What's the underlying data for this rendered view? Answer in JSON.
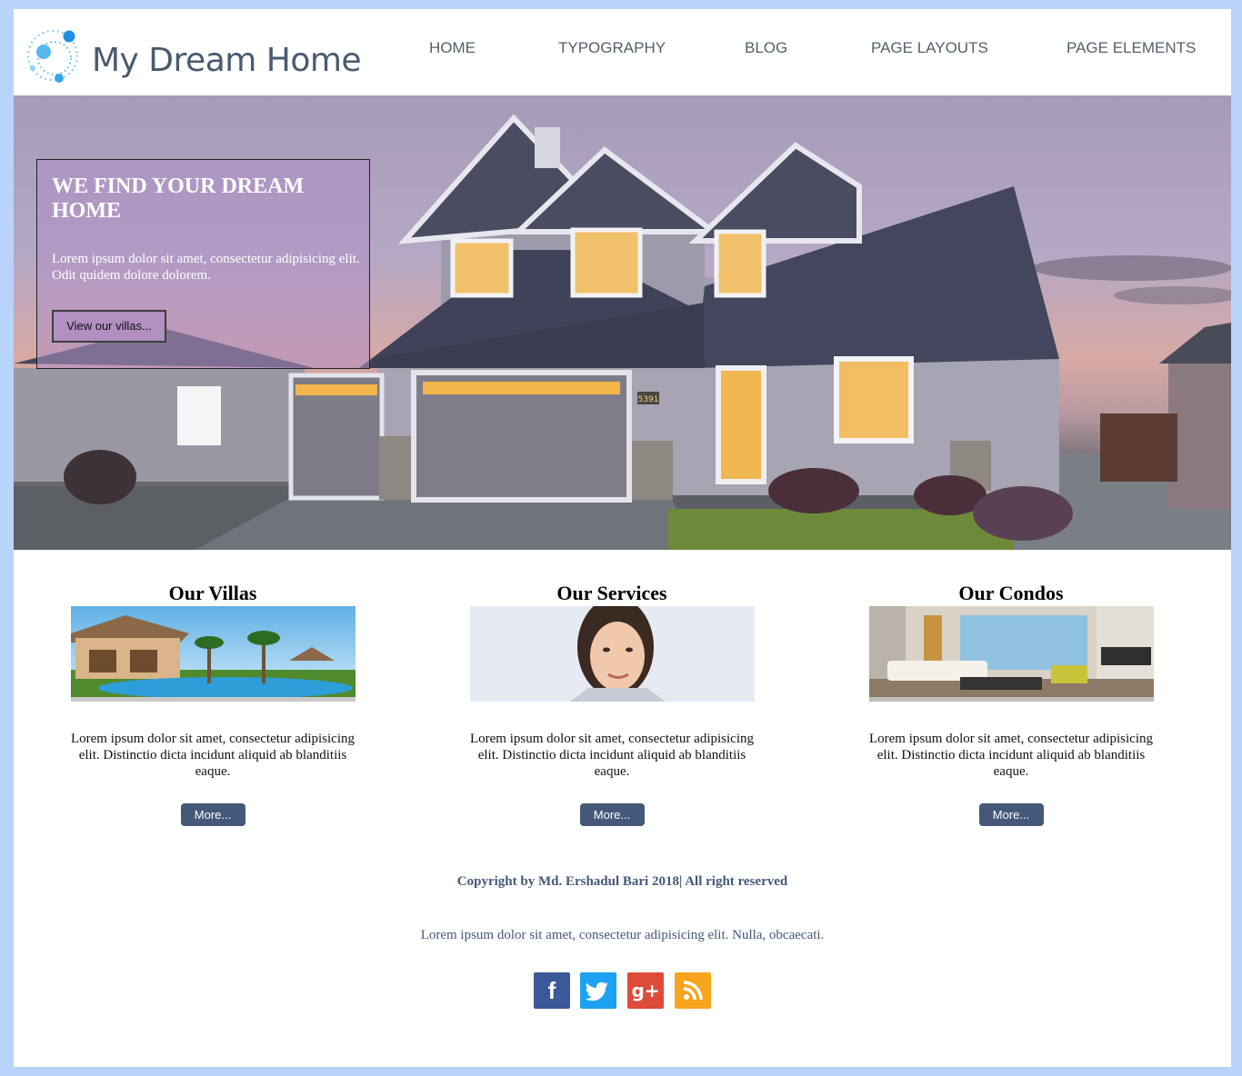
{
  "brand": {
    "name": "My Dream Home",
    "accent_color": "#44597a",
    "background_color": "#b8d4fb"
  },
  "nav": {
    "items": [
      {
        "label": "HOME"
      },
      {
        "label": "TYPOGRAPHY"
      },
      {
        "label": "BLOG"
      },
      {
        "label": "PAGE LAYOUTS"
      },
      {
        "label": "PAGE ELEMENTS"
      }
    ]
  },
  "hero": {
    "title": "WE FIND YOUR DREAM HOME",
    "text": "Lorem ipsum dolor sit amet, consectetur adipisicing elit. Odit quidem dolore dolorem.",
    "button_label": "View our villas...",
    "house_number": "5391"
  },
  "cards": [
    {
      "title": "Our Villas",
      "text": "Lorem ipsum dolor sit amet, consectetur adipisicing elit. Distinctio dicta incidunt aliquid ab blanditiis eaque.",
      "button_label": "More..."
    },
    {
      "title": "Our Services",
      "text": "Lorem ipsum dolor sit amet, consectetur adipisicing elit. Distinctio dicta incidunt aliquid ab blanditiis eaque.",
      "button_label": "More..."
    },
    {
      "title": "Our Condos",
      "text": "Lorem ipsum dolor sit amet, consectetur adipisicing elit. Distinctio dicta incidunt aliquid ab blanditiis eaque.",
      "button_label": "More..."
    }
  ],
  "footer": {
    "copyright": "Copyright by Md. Ershadul Bari 2018| All right reserved",
    "text": "Lorem ipsum dolor sit amet, consectetur adipisicing elit. Nulla, obcaecati.",
    "social": [
      {
        "icon": "facebook-icon",
        "glyph": "f",
        "color": "#3b5998"
      },
      {
        "icon": "twitter-icon",
        "glyph": "t",
        "color": "#1da1f2"
      },
      {
        "icon": "google-plus-icon",
        "glyph": "g+",
        "color": "#dd4b39"
      },
      {
        "icon": "rss-icon",
        "glyph": "rss",
        "color": "#f7a51c"
      }
    ]
  }
}
